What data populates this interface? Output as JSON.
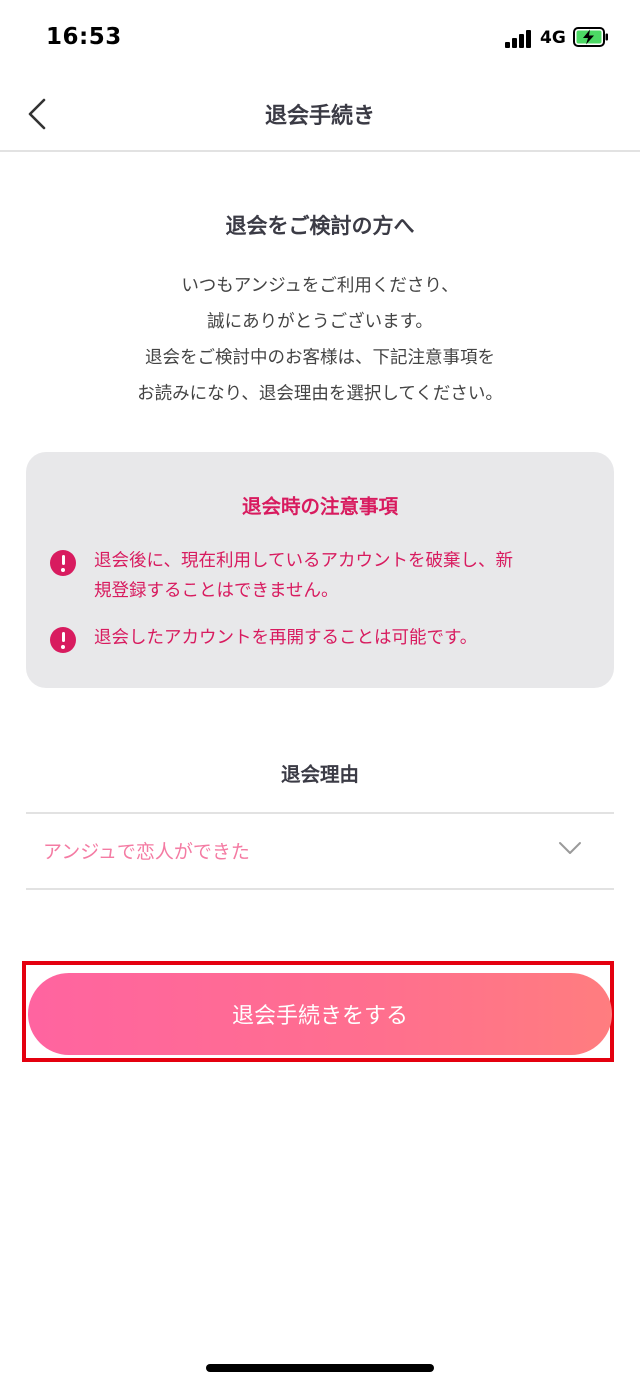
{
  "status_bar": {
    "time": "16:53",
    "network": "4G"
  },
  "nav": {
    "title": "退会手続き",
    "back_icon": "chevron-left-icon"
  },
  "intro": {
    "heading": "退会をご検討の方へ",
    "lines": [
      "いつもアンジュをご利用くださり、",
      "誠にありがとうございます。",
      "退会をご検討中のお客様は、下記注意事項を",
      "お読みになり、退会理由を選択してください。"
    ]
  },
  "notice": {
    "title": "退会時の注意事項",
    "items": [
      {
        "icon": "alert-icon",
        "lines": [
          "退会後に、現在利用しているアカウントを破棄し、新",
          "規登録することはできません。"
        ]
      },
      {
        "icon": "alert-icon",
        "lines": [
          "退会したアカウントを再開することは可能です。"
        ]
      }
    ]
  },
  "reason": {
    "label": "退会理由",
    "selected": "アンジュで恋人ができた"
  },
  "submit": {
    "label": "退会手続きをする"
  },
  "colors": {
    "accent": "#d81b5f",
    "button_start": "#ff64a0",
    "button_end": "#ff7d7f",
    "highlight": "#e4000f"
  }
}
